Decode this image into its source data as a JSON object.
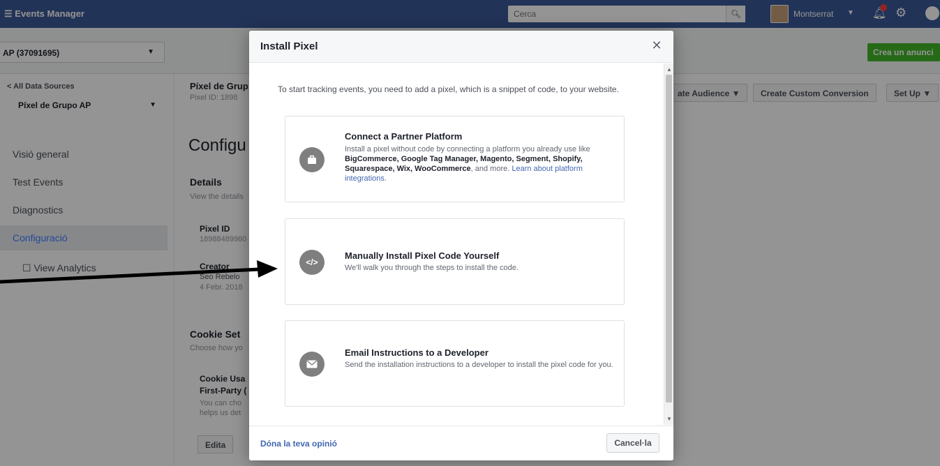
{
  "topbar": {
    "menu_icon": "☰",
    "app_title": "Events Manager",
    "search_placeholder": "Cerca",
    "user_name": "Montserrat",
    "colors": {
      "brand": "#3b5998",
      "notification": "#fa3e3e"
    }
  },
  "account": {
    "selector_label": "AP (37091695)",
    "cta_button": "Crea un anunci"
  },
  "sidebar": {
    "back_link": "< All Data Sources",
    "source_selector": "Píxel de Grupo AP",
    "items": [
      {
        "label": "Visió general"
      },
      {
        "label": "Test Events"
      },
      {
        "label": "Diagnostics"
      },
      {
        "label": "Configuració"
      },
      {
        "label": "View Analytics"
      }
    ]
  },
  "background_main": {
    "pixel_name": "Píxel de Grup",
    "pixel_id_line": "Pixel ID: 1898",
    "page_heading": "Configu",
    "details_heading": "Details",
    "details_sub": "View the details",
    "pixel_id_label": "Pixel ID",
    "pixel_id_value": "18988489960",
    "creator_label": "Creator",
    "creator_name": "Seo Rebelo",
    "creator_date": "4 Febr. 2018",
    "cookie_heading": "Cookie Set",
    "cookie_sub": "Choose how yo",
    "cookie_usage_label": "Cookie Usa",
    "first_party_label": "First-Party (",
    "cookie_desc_1": "You can cho",
    "cookie_desc_2": "helps us det",
    "edit_button": "Edita",
    "create_audience_button": "ate Audience",
    "custom_conversion_button": "Create Custom Conversion",
    "setup_button": "Set Up"
  },
  "modal": {
    "title": "Install Pixel",
    "close_glyph": "✕",
    "intro": "To start tracking events, you need to add a pixel, which is a snippet of code, to your website.",
    "options": [
      {
        "title": "Connect a Partner Platform",
        "desc_1": "Install a pixel without code by connecting a platform you already use like ",
        "desc_bold": "BigCommerce, Google Tag Manager, Magento, Segment, Shopify, Squarespace, Wix, WooCommerce",
        "desc_2": ", and more. ",
        "desc_link": "Learn about platform integrations.",
        "icon": "briefcase-icon"
      },
      {
        "title": "Manually Install Pixel Code Yourself",
        "desc": "We'll walk you through the steps to install the code.",
        "icon": "code-icon"
      },
      {
        "title": "Email Instructions to a Developer",
        "desc": "Send the installation instructions to a developer to install the pixel code for you.",
        "icon": "envelope-icon"
      }
    ],
    "footer": {
      "feedback_link": "Dóna la teva opinió",
      "cancel_button": "Cancel·la"
    }
  }
}
